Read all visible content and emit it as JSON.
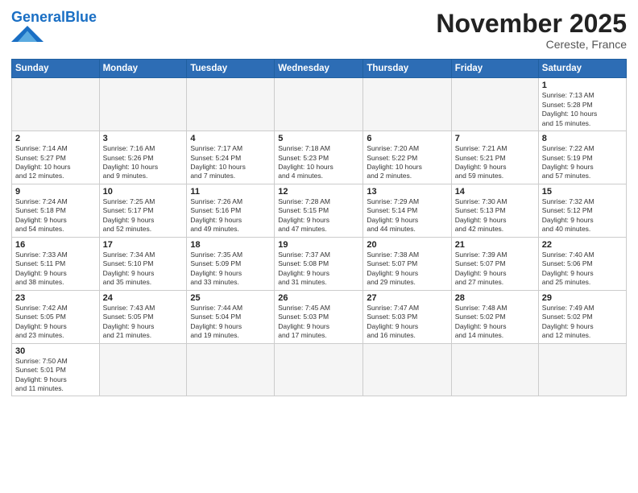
{
  "header": {
    "logo_general": "General",
    "logo_blue": "Blue",
    "month_title": "November 2025",
    "location": "Cereste, France"
  },
  "days_of_week": [
    "Sunday",
    "Monday",
    "Tuesday",
    "Wednesday",
    "Thursday",
    "Friday",
    "Saturday"
  ],
  "weeks": [
    [
      {
        "day": "",
        "info": ""
      },
      {
        "day": "",
        "info": ""
      },
      {
        "day": "",
        "info": ""
      },
      {
        "day": "",
        "info": ""
      },
      {
        "day": "",
        "info": ""
      },
      {
        "day": "",
        "info": ""
      },
      {
        "day": "1",
        "info": "Sunrise: 7:13 AM\nSunset: 5:28 PM\nDaylight: 10 hours\nand 15 minutes."
      }
    ],
    [
      {
        "day": "2",
        "info": "Sunrise: 7:14 AM\nSunset: 5:27 PM\nDaylight: 10 hours\nand 12 minutes."
      },
      {
        "day": "3",
        "info": "Sunrise: 7:16 AM\nSunset: 5:26 PM\nDaylight: 10 hours\nand 9 minutes."
      },
      {
        "day": "4",
        "info": "Sunrise: 7:17 AM\nSunset: 5:24 PM\nDaylight: 10 hours\nand 7 minutes."
      },
      {
        "day": "5",
        "info": "Sunrise: 7:18 AM\nSunset: 5:23 PM\nDaylight: 10 hours\nand 4 minutes."
      },
      {
        "day": "6",
        "info": "Sunrise: 7:20 AM\nSunset: 5:22 PM\nDaylight: 10 hours\nand 2 minutes."
      },
      {
        "day": "7",
        "info": "Sunrise: 7:21 AM\nSunset: 5:21 PM\nDaylight: 9 hours\nand 59 minutes."
      },
      {
        "day": "8",
        "info": "Sunrise: 7:22 AM\nSunset: 5:19 PM\nDaylight: 9 hours\nand 57 minutes."
      }
    ],
    [
      {
        "day": "9",
        "info": "Sunrise: 7:24 AM\nSunset: 5:18 PM\nDaylight: 9 hours\nand 54 minutes."
      },
      {
        "day": "10",
        "info": "Sunrise: 7:25 AM\nSunset: 5:17 PM\nDaylight: 9 hours\nand 52 minutes."
      },
      {
        "day": "11",
        "info": "Sunrise: 7:26 AM\nSunset: 5:16 PM\nDaylight: 9 hours\nand 49 minutes."
      },
      {
        "day": "12",
        "info": "Sunrise: 7:28 AM\nSunset: 5:15 PM\nDaylight: 9 hours\nand 47 minutes."
      },
      {
        "day": "13",
        "info": "Sunrise: 7:29 AM\nSunset: 5:14 PM\nDaylight: 9 hours\nand 44 minutes."
      },
      {
        "day": "14",
        "info": "Sunrise: 7:30 AM\nSunset: 5:13 PM\nDaylight: 9 hours\nand 42 minutes."
      },
      {
        "day": "15",
        "info": "Sunrise: 7:32 AM\nSunset: 5:12 PM\nDaylight: 9 hours\nand 40 minutes."
      }
    ],
    [
      {
        "day": "16",
        "info": "Sunrise: 7:33 AM\nSunset: 5:11 PM\nDaylight: 9 hours\nand 38 minutes."
      },
      {
        "day": "17",
        "info": "Sunrise: 7:34 AM\nSunset: 5:10 PM\nDaylight: 9 hours\nand 35 minutes."
      },
      {
        "day": "18",
        "info": "Sunrise: 7:35 AM\nSunset: 5:09 PM\nDaylight: 9 hours\nand 33 minutes."
      },
      {
        "day": "19",
        "info": "Sunrise: 7:37 AM\nSunset: 5:08 PM\nDaylight: 9 hours\nand 31 minutes."
      },
      {
        "day": "20",
        "info": "Sunrise: 7:38 AM\nSunset: 5:07 PM\nDaylight: 9 hours\nand 29 minutes."
      },
      {
        "day": "21",
        "info": "Sunrise: 7:39 AM\nSunset: 5:07 PM\nDaylight: 9 hours\nand 27 minutes."
      },
      {
        "day": "22",
        "info": "Sunrise: 7:40 AM\nSunset: 5:06 PM\nDaylight: 9 hours\nand 25 minutes."
      }
    ],
    [
      {
        "day": "23",
        "info": "Sunrise: 7:42 AM\nSunset: 5:05 PM\nDaylight: 9 hours\nand 23 minutes."
      },
      {
        "day": "24",
        "info": "Sunrise: 7:43 AM\nSunset: 5:05 PM\nDaylight: 9 hours\nand 21 minutes."
      },
      {
        "day": "25",
        "info": "Sunrise: 7:44 AM\nSunset: 5:04 PM\nDaylight: 9 hours\nand 19 minutes."
      },
      {
        "day": "26",
        "info": "Sunrise: 7:45 AM\nSunset: 5:03 PM\nDaylight: 9 hours\nand 17 minutes."
      },
      {
        "day": "27",
        "info": "Sunrise: 7:47 AM\nSunset: 5:03 PM\nDaylight: 9 hours\nand 16 minutes."
      },
      {
        "day": "28",
        "info": "Sunrise: 7:48 AM\nSunset: 5:02 PM\nDaylight: 9 hours\nand 14 minutes."
      },
      {
        "day": "29",
        "info": "Sunrise: 7:49 AM\nSunset: 5:02 PM\nDaylight: 9 hours\nand 12 minutes."
      }
    ],
    [
      {
        "day": "30",
        "info": "Sunrise: 7:50 AM\nSunset: 5:01 PM\nDaylight: 9 hours\nand 11 minutes."
      },
      {
        "day": "",
        "info": ""
      },
      {
        "day": "",
        "info": ""
      },
      {
        "day": "",
        "info": ""
      },
      {
        "day": "",
        "info": ""
      },
      {
        "day": "",
        "info": ""
      },
      {
        "day": "",
        "info": ""
      }
    ]
  ]
}
